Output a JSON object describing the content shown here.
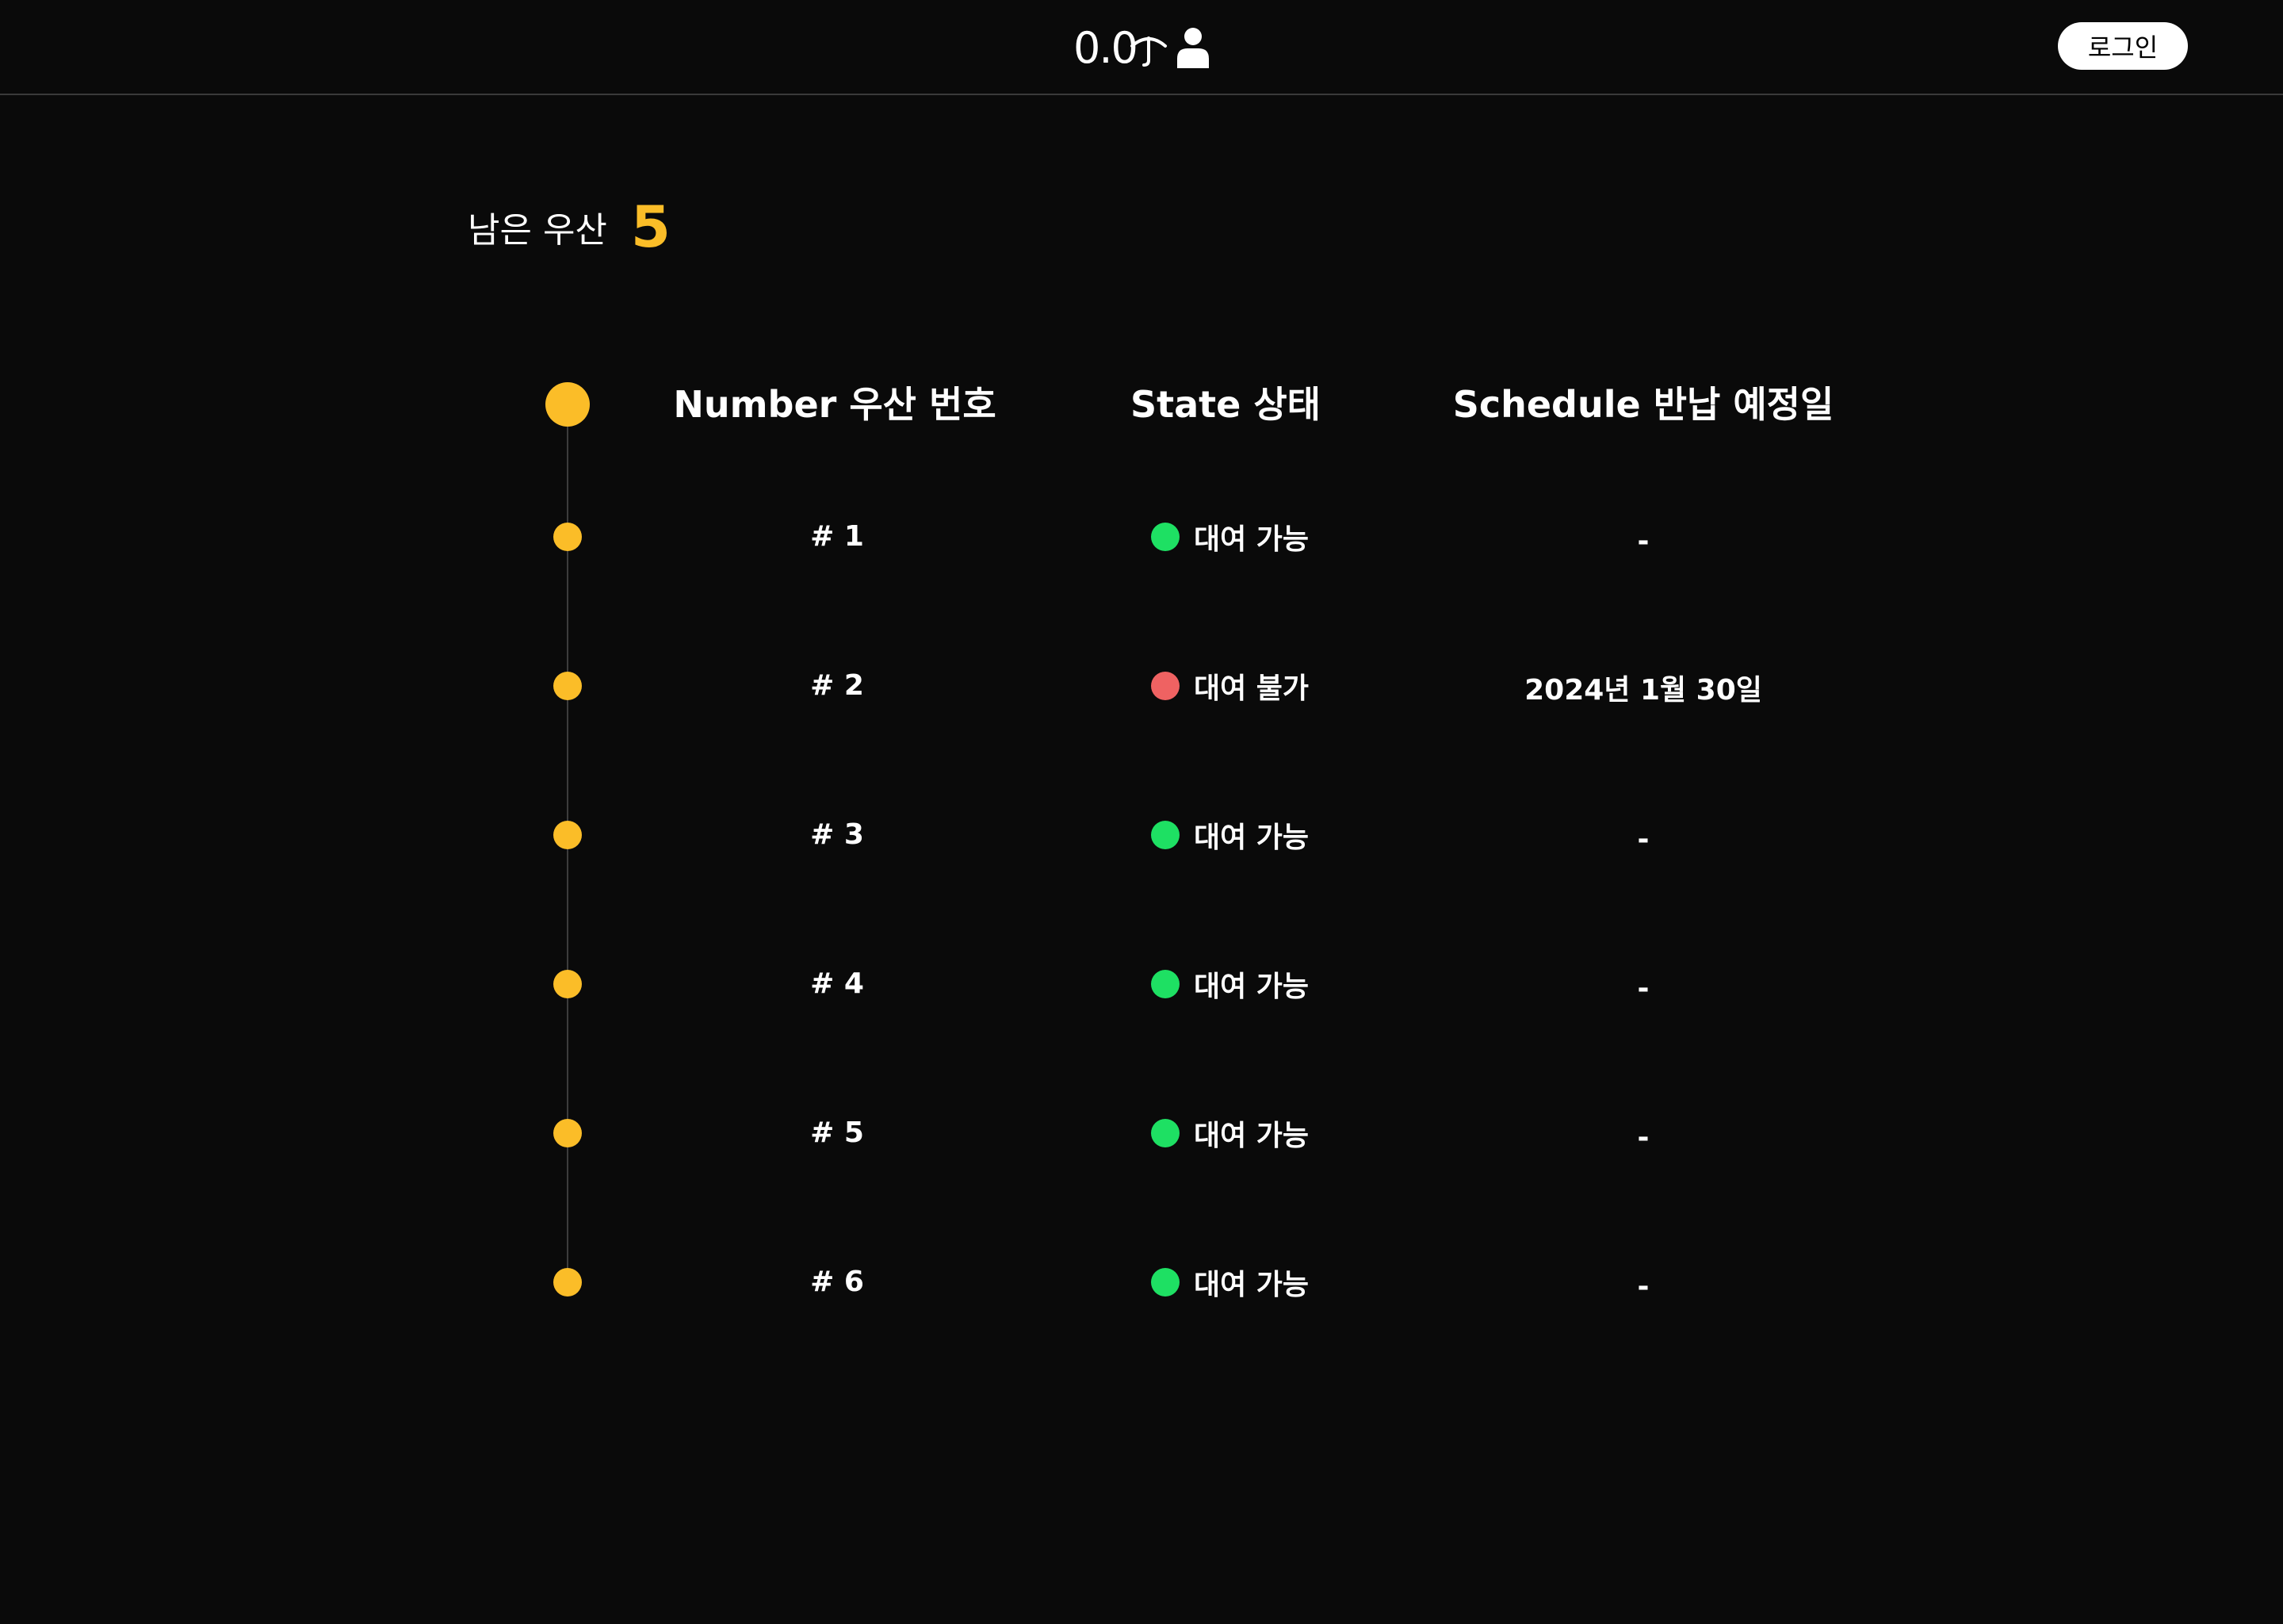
{
  "header": {
    "logo_text": "0.0",
    "login_label": "로그인"
  },
  "remaining": {
    "label": "남은 우산",
    "count": "5"
  },
  "table": {
    "columns": [
      "Number 우산 번호",
      "State 상태",
      "Schedule 반납 예정일"
    ],
    "rows": [
      {
        "number": "# 1",
        "state": "대여 가능",
        "state_color": "#1ee063",
        "schedule": "-"
      },
      {
        "number": "# 2",
        "state": "대여 불가",
        "state_color": "#ef6262",
        "schedule": "2024년 1월 30일"
      },
      {
        "number": "# 3",
        "state": "대여 가능",
        "state_color": "#1ee063",
        "schedule": "-"
      },
      {
        "number": "# 4",
        "state": "대여 가능",
        "state_color": "#1ee063",
        "schedule": "-"
      },
      {
        "number": "# 5",
        "state": "대여 가능",
        "state_color": "#1ee063",
        "schedule": "-"
      },
      {
        "number": "# 6",
        "state": "대여 가능",
        "state_color": "#1ee063",
        "schedule": "-"
      }
    ]
  },
  "colors": {
    "background": "#0a0a0a",
    "accent": "#fbbd28",
    "available": "#1ee063",
    "unavailable": "#ef6262"
  },
  "icons": {
    "logo": "umbrella-icon",
    "user": "user-icon"
  }
}
